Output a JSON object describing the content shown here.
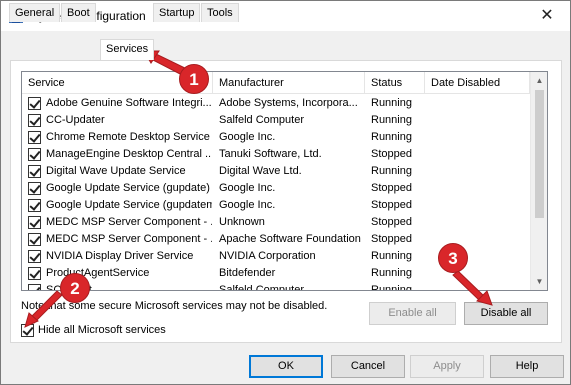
{
  "window": {
    "title": "System Configuration",
    "close_glyph": "✕",
    "icon": "msconfig-icon"
  },
  "tabs": [
    {
      "label": "General",
      "active": false
    },
    {
      "label": "Boot",
      "active": false
    },
    {
      "label": "Services",
      "active": true
    },
    {
      "label": "Startup",
      "active": false
    },
    {
      "label": "Tools",
      "active": false
    }
  ],
  "services": {
    "columns": [
      "Service",
      "Manufacturer",
      "Status",
      "Date Disabled"
    ],
    "rows": [
      {
        "checked": true,
        "service": "Adobe Genuine Software Integri...",
        "manufacturer": "Adobe Systems, Incorpora...",
        "status": "Running",
        "date_disabled": ""
      },
      {
        "checked": true,
        "service": "CC-Updater",
        "manufacturer": "Salfeld Computer",
        "status": "Running",
        "date_disabled": ""
      },
      {
        "checked": true,
        "service": "Chrome Remote Desktop Service",
        "manufacturer": "Google Inc.",
        "status": "Running",
        "date_disabled": ""
      },
      {
        "checked": true,
        "service": "ManageEngine Desktop Central ...",
        "manufacturer": "Tanuki Software, Ltd.",
        "status": "Stopped",
        "date_disabled": ""
      },
      {
        "checked": true,
        "service": "Digital Wave Update Service",
        "manufacturer": "Digital Wave Ltd.",
        "status": "Running",
        "date_disabled": ""
      },
      {
        "checked": true,
        "service": "Google Update Service (gupdate)",
        "manufacturer": "Google Inc.",
        "status": "Stopped",
        "date_disabled": ""
      },
      {
        "checked": true,
        "service": "Google Update Service (gupdatem)",
        "manufacturer": "Google Inc.",
        "status": "Stopped",
        "date_disabled": ""
      },
      {
        "checked": true,
        "service": "MEDC MSP Server Component - ...",
        "manufacturer": "Unknown",
        "status": "Stopped",
        "date_disabled": ""
      },
      {
        "checked": true,
        "service": "MEDC MSP Server Component - ...",
        "manufacturer": "Apache Software Foundation",
        "status": "Stopped",
        "date_disabled": ""
      },
      {
        "checked": true,
        "service": "NVIDIA Display Driver Service",
        "manufacturer": "NVIDIA Corporation",
        "status": "Running",
        "date_disabled": ""
      },
      {
        "checked": true,
        "service": "ProductAgentService",
        "manufacturer": "Bitdefender",
        "status": "Running",
        "date_disabled": ""
      },
      {
        "checked": true,
        "service": "SCCHost",
        "manufacturer": "Salfeld Computer",
        "status": "Running",
        "date_disabled": ""
      }
    ]
  },
  "note": "Note that some secure Microsoft services may not be disabled.",
  "buttons": {
    "enable_all": "Enable all",
    "disable_all": "Disable all",
    "ok": "OK",
    "cancel": "Cancel",
    "apply": "Apply",
    "help": "Help"
  },
  "hide_ms": {
    "label": "Hide all Microsoft services",
    "checked": true
  },
  "markers": [
    "1",
    "2",
    "3"
  ],
  "colors": {
    "marker": "#d9262a",
    "accent": "#0078d7"
  }
}
